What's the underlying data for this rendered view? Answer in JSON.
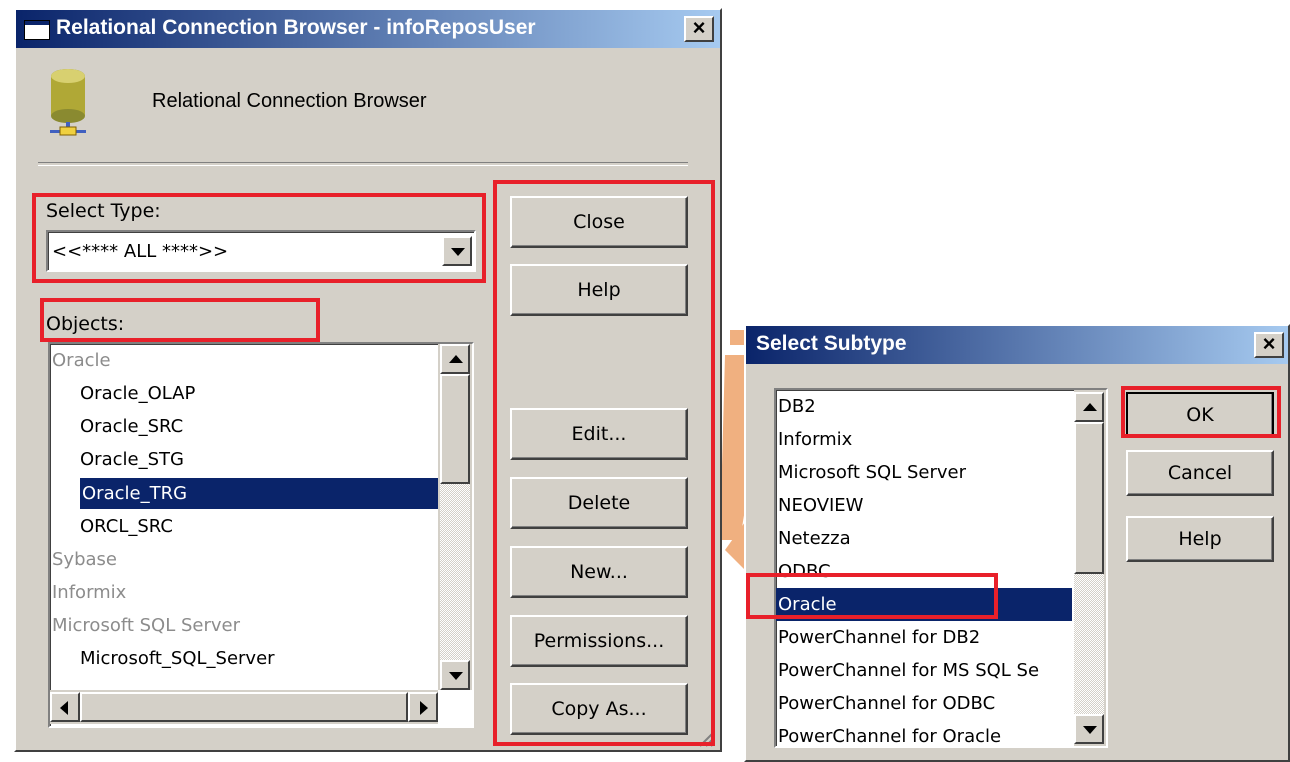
{
  "rcb": {
    "title": "Relational Connection Browser - infoReposUser",
    "header_text": "Relational Connection Browser",
    "select_type_label": "Select Type:",
    "select_type_value": "<<**** ALL ****>>",
    "objects_label": "Objects:",
    "objects": [
      {
        "text": "Oracle",
        "kind": "group"
      },
      {
        "text": "Oracle_OLAP",
        "kind": "item"
      },
      {
        "text": "Oracle_SRC",
        "kind": "item"
      },
      {
        "text": "Oracle_STG",
        "kind": "item"
      },
      {
        "text": "Oracle_TRG",
        "kind": "selected"
      },
      {
        "text": "ORCL_SRC",
        "kind": "item"
      },
      {
        "text": "Sybase",
        "kind": "group"
      },
      {
        "text": "Informix",
        "kind": "group"
      },
      {
        "text": "Microsoft SQL Server",
        "kind": "group"
      },
      {
        "text": "Microsoft_SQL_Server",
        "kind": "item"
      }
    ],
    "buttons": {
      "close": "Close",
      "help": "Help",
      "edit": "Edit...",
      "delete": "Delete",
      "new": "New...",
      "permissions": "Permissions...",
      "copy_as": "Copy As..."
    }
  },
  "subtype": {
    "title": "Select Subtype",
    "items": [
      {
        "text": "DB2",
        "kind": "item"
      },
      {
        "text": "Informix",
        "kind": "item"
      },
      {
        "text": "Microsoft SQL Server",
        "kind": "item"
      },
      {
        "text": "NEOVIEW",
        "kind": "item"
      },
      {
        "text": "Netezza",
        "kind": "item"
      },
      {
        "text": "ODBC",
        "kind": "item"
      },
      {
        "text": "Oracle",
        "kind": "selected"
      },
      {
        "text": "PowerChannel for DB2",
        "kind": "item"
      },
      {
        "text": "PowerChannel for MS SQL Se",
        "kind": "item"
      },
      {
        "text": "PowerChannel for ODBC",
        "kind": "item"
      },
      {
        "text": "PowerChannel for Oracle",
        "kind": "item"
      }
    ],
    "buttons": {
      "ok": "OK",
      "cancel": "Cancel",
      "help": "Help"
    }
  },
  "colors": {
    "titlebar_start": "#0a246a",
    "titlebar_end": "#a6caf0",
    "highlight": "#0a246a",
    "annotation_red": "#e8202a",
    "arrow_orange": "#f0b080",
    "dialog_face": "#d4d0c8"
  }
}
